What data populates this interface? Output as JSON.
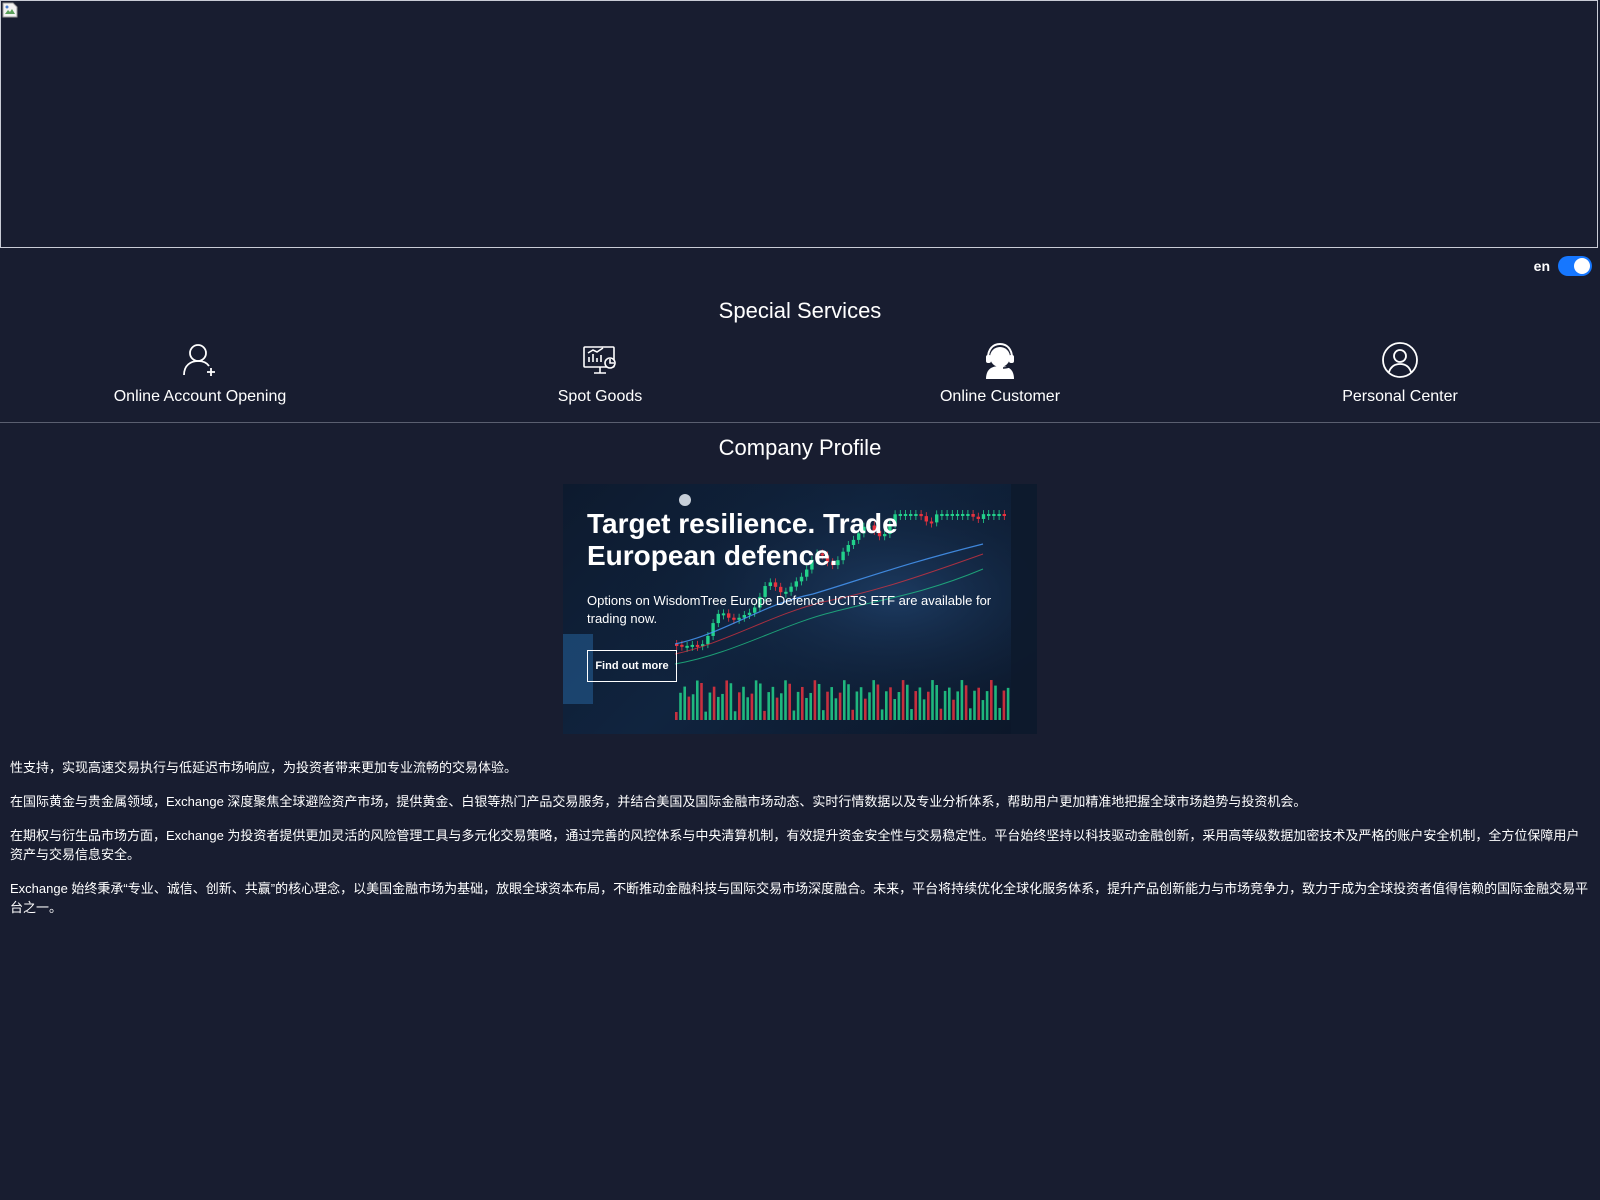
{
  "language": {
    "label": "en",
    "toggle_on": true,
    "accent": "#1677ff"
  },
  "special_services": {
    "title": "Special Services",
    "items": [
      {
        "label": "Online Account Opening",
        "icon": "user-add-icon"
      },
      {
        "label": "Spot Goods",
        "icon": "chart-monitor-icon"
      },
      {
        "label": "Online Customer",
        "icon": "headset-agent-icon"
      },
      {
        "label": "Personal Center",
        "icon": "user-circle-icon"
      }
    ]
  },
  "company_profile": {
    "title": "Company Profile",
    "promo": {
      "headline": "Target resilience. Trade European defence.",
      "subtext": "Options on WisdomTree Europe Defence UCITS ETF are available for trading now.",
      "button": "Find out more"
    },
    "paragraphs": [
      "性支持，实现高速交易执行与低延迟市场响应，为投资者带来更加专业流畅的交易体验。",
      "在国际黄金与贵金属领域，Exchange 深度聚焦全球避险资产市场，提供黄金、白银等热门产品交易服务，并结合美国及国际金融市场动态、实时行情数据以及专业分析体系，帮助用户更加精准地把握全球市场趋势与投资机会。",
      "在期权与衍生品市场方面，Exchange 为投资者提供更加灵活的风险管理工具与多元化交易策略，通过完善的风控体系与中央清算机制，有效提升资金安全性与交易稳定性。平台始终坚持以科技驱动金融创新，采用高等级数据加密技术及严格的账户安全机制，全方位保障用户资产与交易信息安全。",
      "Exchange 始终秉承“专业、诚信、创新、共赢”的核心理念，以美国金融市场为基础，放眼全球资本布局，不断推动金融科技与国际交易市场深度融合。未来，平台将持续优化全球化服务体系，提升产品创新能力与市场竞争力，致力于成为全球投资者值得信赖的国际金融交易平台之一。"
    ]
  },
  "colors": {
    "background": "#181d30",
    "divider": "#5a5f70",
    "candle_up": "#22d18b",
    "candle_down": "#e8333f"
  }
}
